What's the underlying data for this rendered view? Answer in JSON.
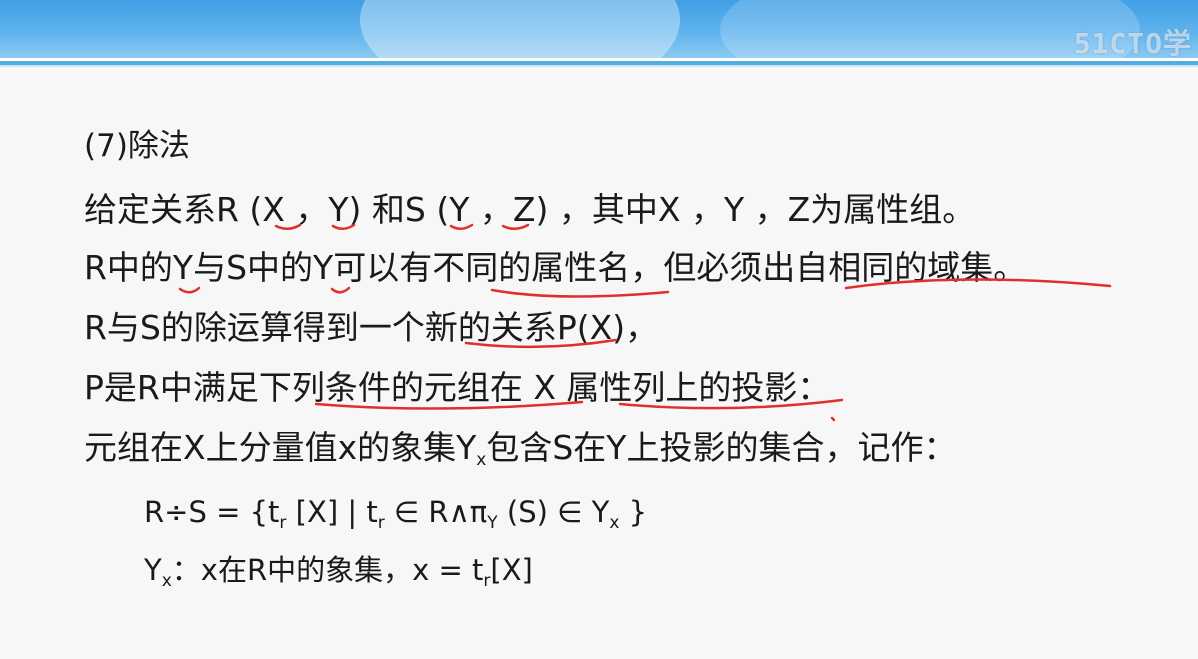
{
  "watermark": "51CTO学",
  "section_title": "(7)除法",
  "line_given": "给定关系R (X ，Y) 和S (Y ，Z) ，其中X ，Y ，Z为属性组。",
  "line_y_domain": "R中的Y与S中的Y可以有不同的属性名，但必须出自相同的域集。",
  "line_result": "R与S的除运算得到一个新的关系P(X)，",
  "line_p_def": "P是R中满足下列条件的元组在 X 属性列上的投影：",
  "line_condition": {
    "before_sub": "元组在X上分量值x的象集Y",
    "sub": "x",
    "after_sub": "包含S在Y上投影的集合，记作："
  },
  "formula_division": {
    "part1": "R÷S = {t",
    "sub1": "r",
    "part2": " [X] | t",
    "sub2": "r",
    "part3": " ∈ R∧π",
    "sub3": "Y",
    "part4": " (S) ∈ Y",
    "sub4": "x",
    "part5": " }"
  },
  "formula_image_set": {
    "part1": "Y",
    "sub1": "x",
    "part2": "：x在R中的象集，x = t",
    "sub2": "r",
    "part3": "[X]"
  },
  "colors": {
    "header_blue": "#3f9fe6",
    "annotation_red": "#e0302a",
    "text": "#1a1a1a"
  }
}
